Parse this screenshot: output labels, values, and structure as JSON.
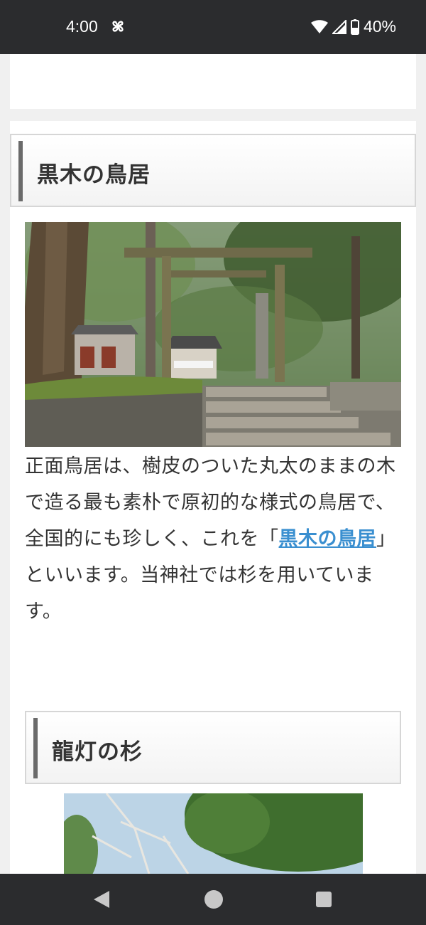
{
  "status_bar": {
    "time": "4:00",
    "battery": "40%",
    "icons": [
      "pinwheel-icon",
      "wifi-icon",
      "cellular-signal-icon",
      "battery-icon"
    ]
  },
  "sections": [
    {
      "heading": "黒木の鳥居",
      "image_description_icon": "torii-photo",
      "paragraph_before_link": "正面鳥居は、樹皮のついた丸太のままの木で造る最も素朴で原初的な様式の鳥居で、全国的にも珍しく、これを「",
      "link_text": "黒木の鳥居",
      "paragraph_after_link": "」といいます。当神社では杉を用いています。"
    },
    {
      "heading": "龍灯の杉",
      "image_description_icon": "cedar-photo"
    }
  ],
  "nav_bar": {
    "icons": [
      "back-icon",
      "home-icon",
      "recent-apps-icon"
    ]
  },
  "colors": {
    "status_bar_bg": "#2b2c2e",
    "link": "#3a8fd0",
    "heading_accent": "#6a6a6a"
  }
}
